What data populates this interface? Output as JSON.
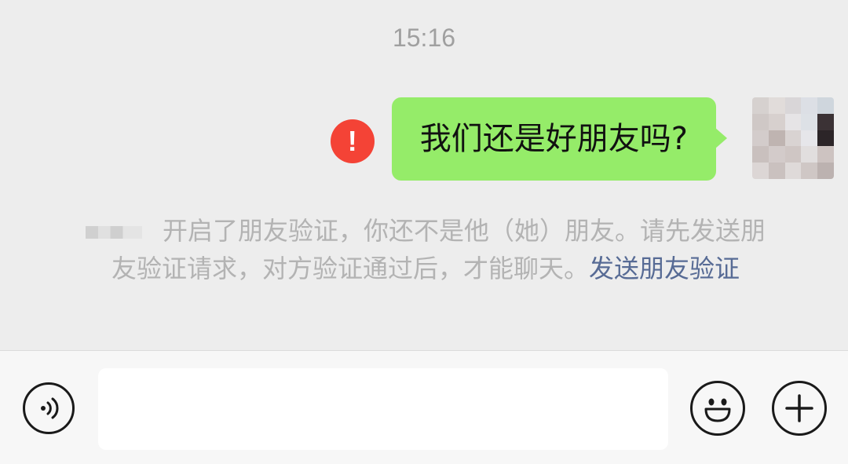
{
  "chat": {
    "timestamp": "15:16",
    "message": {
      "text": "我们还是好朋友吗?",
      "status_icon": "exclamation-error-icon",
      "status_symbol": "!"
    },
    "avatar": {
      "icon": "pixelated-avatar"
    },
    "system_notice": {
      "text": "开启了朋友验证，你还不是他（她）朋友。请先发送朋友验证请求，对方验证通过后，才能聊天。",
      "link_text": "发送朋友验证"
    }
  },
  "input_bar": {
    "voice_icon": "voice-icon",
    "text_value": "",
    "emoji_icon": "emoji-icon",
    "plus_icon": "plus-icon"
  },
  "colors": {
    "background": "#ededed",
    "bubble_green": "#95ec69",
    "error_red": "#f44336",
    "link_blue": "#576b95",
    "notice_gray": "#b3b3b3"
  }
}
